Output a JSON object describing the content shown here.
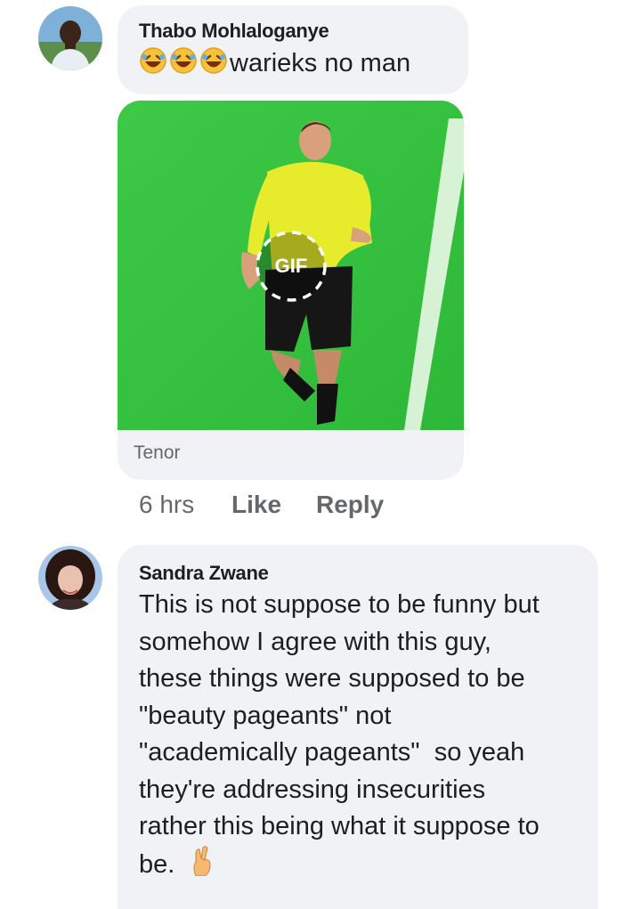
{
  "comments": [
    {
      "author": "Thabo Mohlaloganye",
      "text": "warieks no man",
      "emojis": [
        "rolling-on-floor-laughing-icon",
        "rolling-on-floor-laughing-icon",
        "rolling-on-floor-laughing-icon"
      ],
      "attachment": {
        "type": "gif",
        "badge": "GIF",
        "source": "Tenor"
      },
      "actions": {
        "time": "6 hrs",
        "like": "Like",
        "reply": "Reply"
      }
    },
    {
      "author": "Sandra Zwane",
      "text_lines": [
        "This is not suppose to be funny but",
        "somehow I agree with this guy,",
        "these things were supposed to be",
        "\"beauty pageants\" not",
        "\"academically pageants\"  so yeah",
        "they're addressing insecurities",
        "rather this being what it suppose to",
        "be."
      ],
      "trailing_emoji": "crossed-fingers-icon"
    }
  ],
  "colors": {
    "bubble": "#f0f2f5",
    "text": "#1c1e21",
    "meta": "#65676b",
    "pitch": "#33c23d"
  }
}
